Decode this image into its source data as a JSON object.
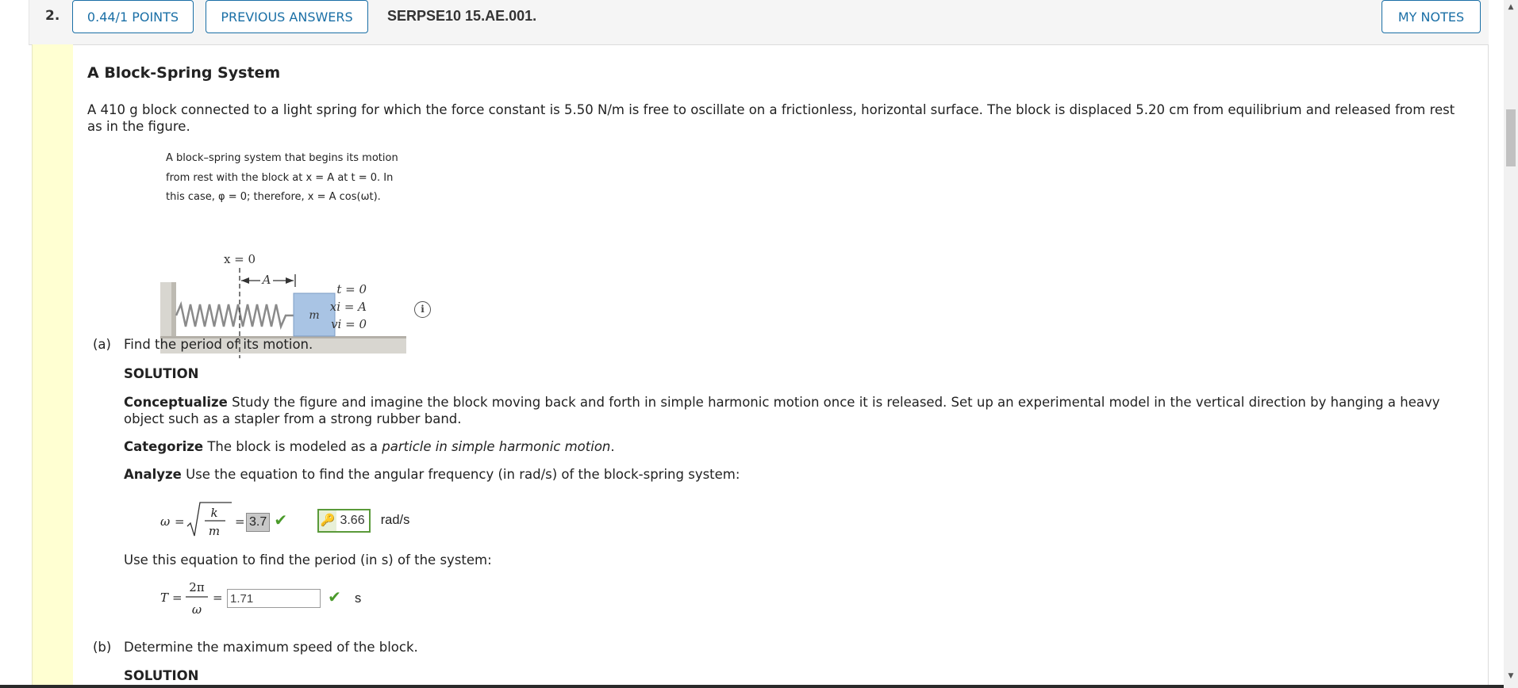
{
  "question": {
    "number": "2.",
    "points": "0.44/1 POINTS",
    "previous_answers": "PREVIOUS ANSWERS",
    "id": "SERPSE10 15.AE.001.",
    "my_notes": "MY NOTES"
  },
  "title": "A Block-Spring System",
  "intro": "A 410 g block connected to a light spring for which the force constant is 5.50 N/m is free to oscillate on a frictionless, horizontal surface. The block is displaced 5.20 cm from equilibrium and released from rest as in the figure.",
  "figure": {
    "caption_1": "A block–spring system that begins its motion",
    "caption_2": "from rest with the block at x = A at t = 0. In",
    "caption_3": "this case, φ = 0; therefore, x = A cos(ωt).",
    "x0_label": "x = 0",
    "a_label": "A",
    "mass_label": "m",
    "t0": "t = 0",
    "xi": "xi = A",
    "vi": "vi = 0",
    "info_icon": "i"
  },
  "part_a": {
    "label": "(a)",
    "question": "Find the period of its motion.",
    "solution": "SOLUTION",
    "conceptualize_head": "Conceptualize",
    "conceptualize": "Study the figure and imagine the block moving back and forth in simple harmonic motion once it is released. Set up an experimental model in the vertical direction by hanging a heavy object such as a stapler from a strong rubber band.",
    "categorize_head": "Categorize",
    "categorize_pre": "The block is modeled as a",
    "categorize_em": "particle in simple harmonic motion",
    "categorize_post": ".",
    "analyze_head": "Analyze",
    "analyze": "Use the equation to find the angular frequency (in rad/s) of the block-spring system:",
    "omega_answer": "3.7",
    "omega_key": "3.66",
    "omega_unit": "rad/s",
    "period_text": "Use this equation to find the period (in s) of the system:",
    "period_answer": "1.71",
    "period_unit": "s"
  },
  "part_b": {
    "label": "(b)",
    "question": "Determine the maximum speed of the block.",
    "solution": "SOLUTION"
  },
  "colors": {
    "accent": "#1a6fa6",
    "yellow_strip": "#ffffd2",
    "check_green": "#4a9a2a",
    "block_blue": "#a9c4e4"
  }
}
